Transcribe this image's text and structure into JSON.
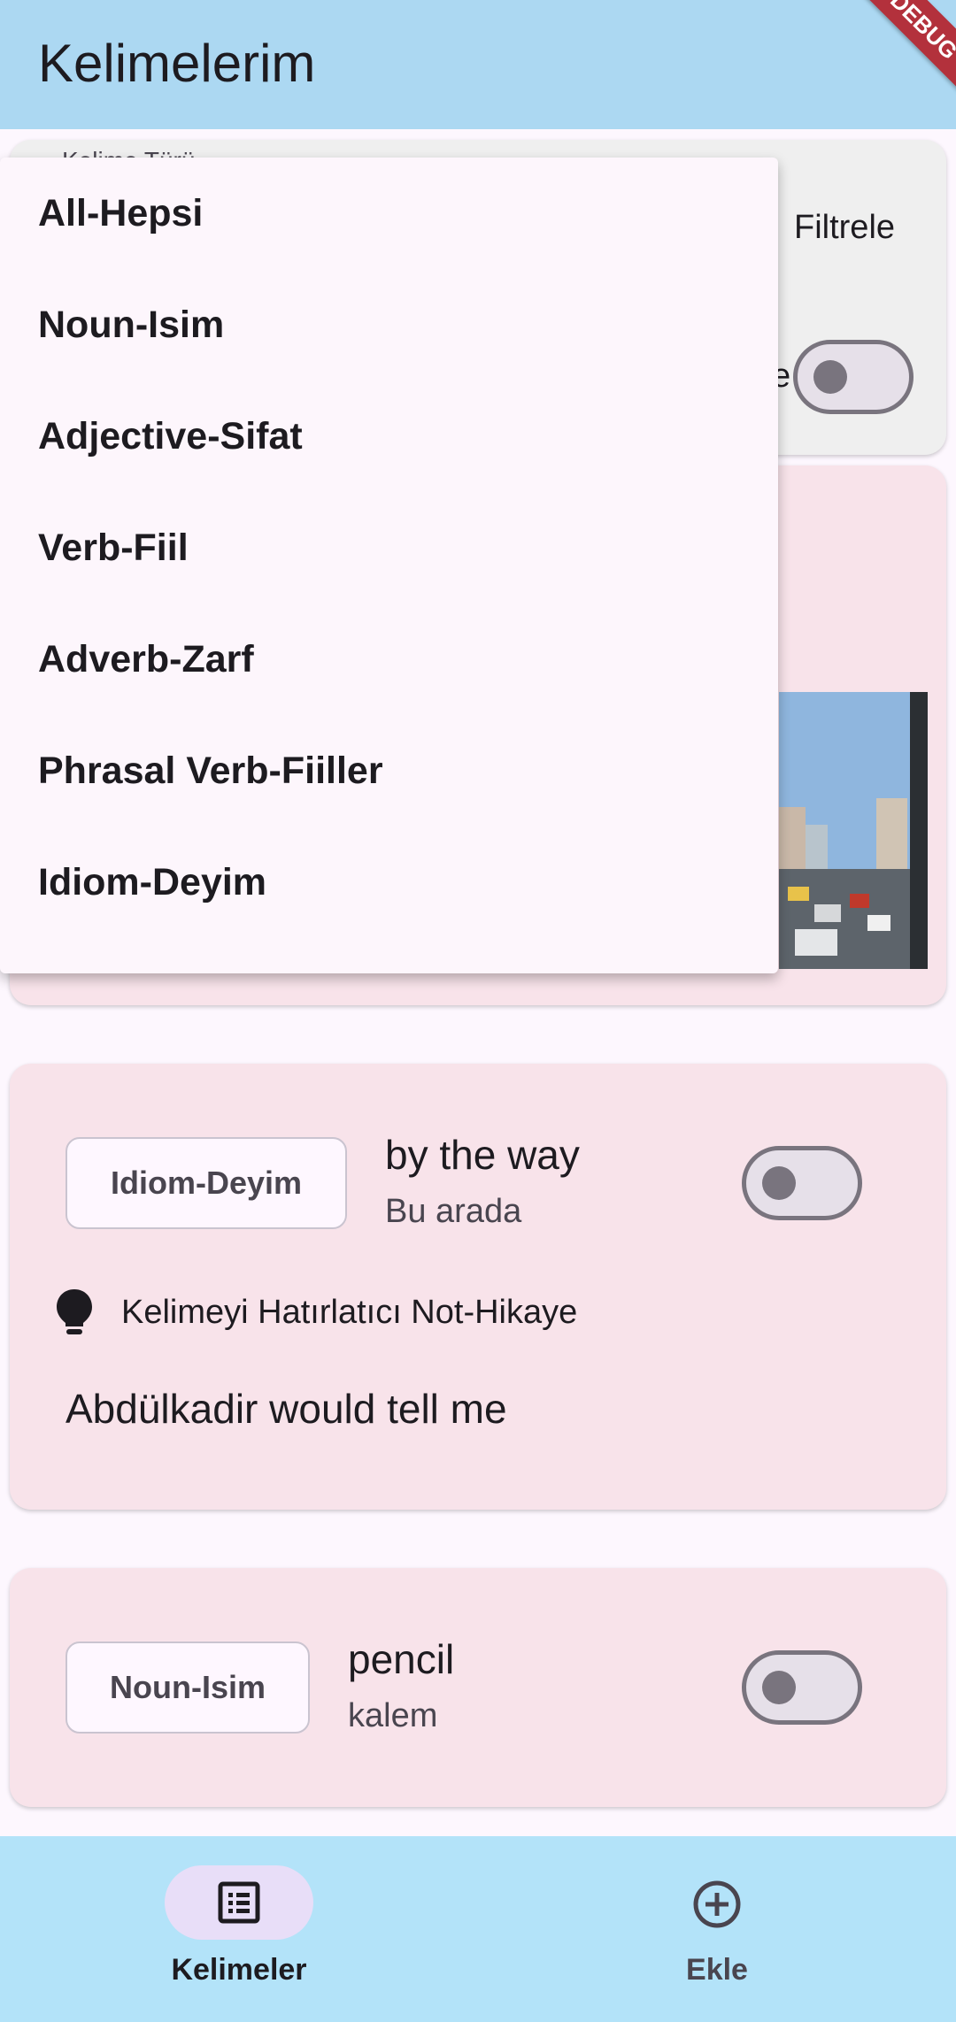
{
  "app_title": "Kelimelerim",
  "debug_banner": "DEBUG",
  "filter": {
    "label_partial": "Kelime Türü",
    "button_label": "Filtrele",
    "trailing_char": "e"
  },
  "dropdown": {
    "items": [
      "All-Hepsi",
      "Noun-Isim",
      "Adjective-Sifat",
      "Verb-Fiil",
      "Adverb-Zarf",
      "Phrasal Verb-Fiiller",
      "Idiom-Deyim"
    ]
  },
  "cards": [
    {
      "type": "Idiom-Deyim",
      "english": "by the way",
      "turkish": "Bu arada",
      "learned": false,
      "note_label": "Kelimeyi Hatırlatıcı Not-Hikaye",
      "note_text": "Abdülkadir would tell me"
    },
    {
      "type": "Noun-Isim",
      "english": "pencil",
      "turkish": "kalem",
      "learned": false
    }
  ],
  "bottom_nav": {
    "items": [
      {
        "label": "Kelimeler",
        "icon": "list-alt-icon",
        "selected": true
      },
      {
        "label": "Ekle",
        "icon": "add-circle-icon",
        "selected": false
      }
    ]
  },
  "colors": {
    "appbar": "#acd8f2",
    "bottom_nav": "#b3e3f9",
    "card": "#f8e3ea",
    "menu": "#fdf6fc",
    "selected_pill": "#e8def8"
  }
}
